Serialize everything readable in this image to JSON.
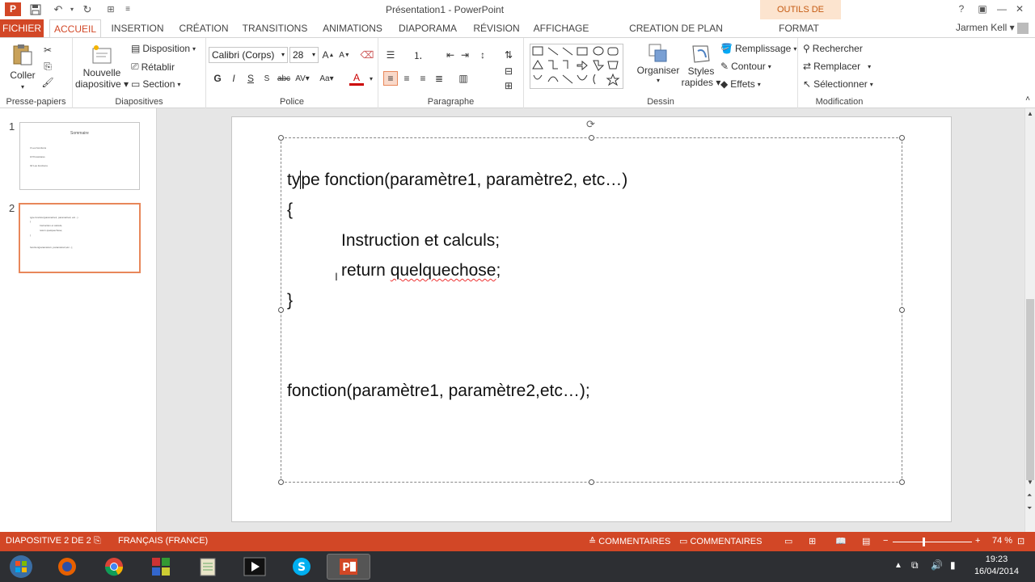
{
  "window": {
    "title": "Présentation1 - PowerPoint",
    "context_tools": "OUTILS DE DESSIN",
    "user": "Jarmen Kell"
  },
  "tabs": [
    {
      "label": "FICHIER"
    },
    {
      "label": "ACCUEIL"
    },
    {
      "label": "INSERTION"
    },
    {
      "label": "CRÉATION"
    },
    {
      "label": "TRANSITIONS"
    },
    {
      "label": "ANIMATIONS"
    },
    {
      "label": "DIAPORAMA"
    },
    {
      "label": "RÉVISION"
    },
    {
      "label": "AFFICHAGE"
    },
    {
      "label": "CREATION DE PLAN CONCEPTUEL"
    },
    {
      "label": "FORMAT"
    }
  ],
  "ribbon": {
    "clipboard": {
      "paste": "Coller",
      "label": "Presse-papiers"
    },
    "slides": {
      "new_slide": "Nouvelle",
      "new_slide2": "diapositive",
      "layout": "Disposition",
      "reset": "Rétablir",
      "section": "Section",
      "label": "Diapositives"
    },
    "font": {
      "name": "Calibri (Corps)",
      "size": "28",
      "label": "Police"
    },
    "paragraph": {
      "label": "Paragraphe"
    },
    "drawing": {
      "arrange": "Organiser",
      "quick_styles": "Styles",
      "quick_styles2": "rapides",
      "fill": "Remplissage",
      "outline": "Contour",
      "effects": "Effets",
      "label": "Dessin"
    },
    "editing": {
      "find": "Rechercher",
      "replace": "Remplacer",
      "select": "Sélectionner",
      "label": "Modification"
    }
  },
  "slides": [
    {
      "number": "1",
      "title": "Sommaire",
      "lines": [
        "I/ Les fonctions",
        "II/ Procédures",
        "III/ Les fonctions"
      ]
    },
    {
      "number": "2",
      "lines": [
        "type fonction(paramètre1, paramètre2, etc...)",
        "{",
        "Instruction et calculs;",
        "return quelquechose;",
        "}",
        "fonction(paramètre1, paramètre2,etc...);"
      ]
    }
  ],
  "slide_text": {
    "line1_pre": "ty",
    "line1_post": "pe fonction(paramètre1, paramètre2, etc…)",
    "line2": "{",
    "line3": "Instruction et calculs;",
    "line4_pre": "return ",
    "line4_word": "quelquechose",
    "line4_post": ";",
    "line5": "}",
    "line6": "fonction(paramètre1, paramètre2,etc…);"
  },
  "status": {
    "slide": "DIAPOSITIVE 2 DE 2",
    "language": "FRANÇAIS (FRANCE)",
    "notes": "COMMENTAIRES",
    "comments": "COMMENTAIRES",
    "zoom": "74 %"
  },
  "taskbar": {
    "time": "19:23",
    "date": "16/04/2014"
  },
  "colors": {
    "accent": "#d24726",
    "taskbar": "#2d2f33"
  }
}
